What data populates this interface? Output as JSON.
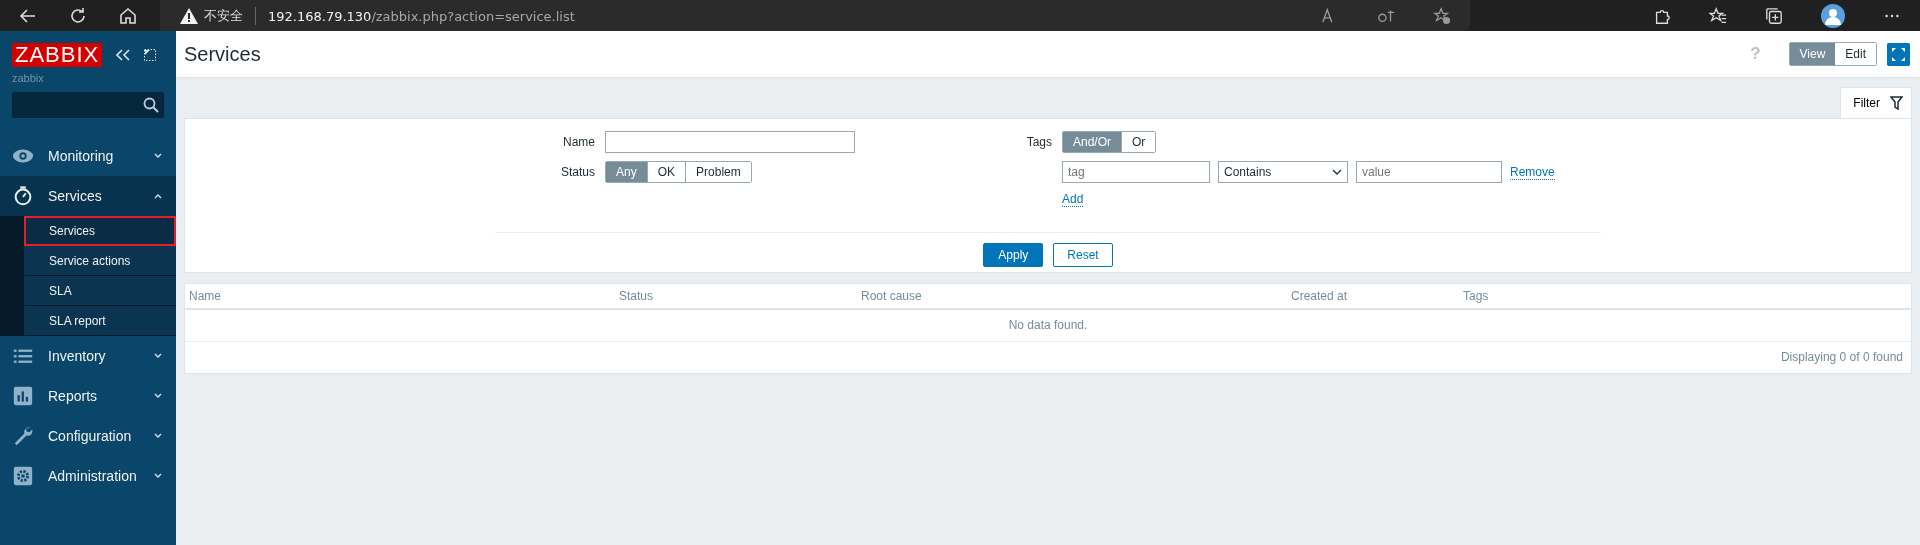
{
  "browser": {
    "security_label": "不安全",
    "url_host": "192.168.79.130",
    "url_path": "/zabbix.php?action=service.list"
  },
  "sidebar": {
    "logo": "ZABBIX",
    "server_name": "zabbix",
    "menu": [
      {
        "label": "Monitoring",
        "kind": "eye",
        "expanded": false
      },
      {
        "label": "Services",
        "kind": "stopwatch",
        "expanded": true,
        "children": [
          {
            "label": "Services",
            "selected": true,
            "highlighted": true
          },
          {
            "label": "Service actions",
            "selected": false,
            "highlighted": false
          },
          {
            "label": "SLA",
            "selected": false,
            "highlighted": false
          },
          {
            "label": "SLA report",
            "selected": false,
            "highlighted": false
          }
        ]
      },
      {
        "label": "Inventory",
        "kind": "list",
        "expanded": false
      },
      {
        "label": "Reports",
        "kind": "chart",
        "expanded": false
      },
      {
        "label": "Configuration",
        "kind": "wrench",
        "expanded": false
      },
      {
        "label": "Administration",
        "kind": "gear",
        "expanded": false
      }
    ]
  },
  "header": {
    "title": "Services",
    "help": "?",
    "modes": [
      {
        "label": "View",
        "selected": true
      },
      {
        "label": "Edit",
        "selected": false
      }
    ]
  },
  "filter": {
    "tab_label": "Filter",
    "name_label": "Name",
    "status_label": "Status",
    "status_options": [
      {
        "label": "Any",
        "selected": true
      },
      {
        "label": "OK",
        "selected": false
      },
      {
        "label": "Problem",
        "selected": false
      }
    ],
    "tags_label": "Tags",
    "tags_options": [
      {
        "label": "And/Or",
        "selected": true
      },
      {
        "label": "Or",
        "selected": false
      }
    ],
    "tag_placeholder": "tag",
    "operator": "Contains",
    "value_placeholder": "value",
    "remove": "Remove",
    "add": "Add",
    "apply": "Apply",
    "reset": "Reset"
  },
  "table": {
    "columns": [
      "Name",
      "Status",
      "Root cause",
      "Created at",
      "Tags"
    ],
    "empty_message": "No data found.",
    "footer": "Displaying 0 of 0 found"
  }
}
